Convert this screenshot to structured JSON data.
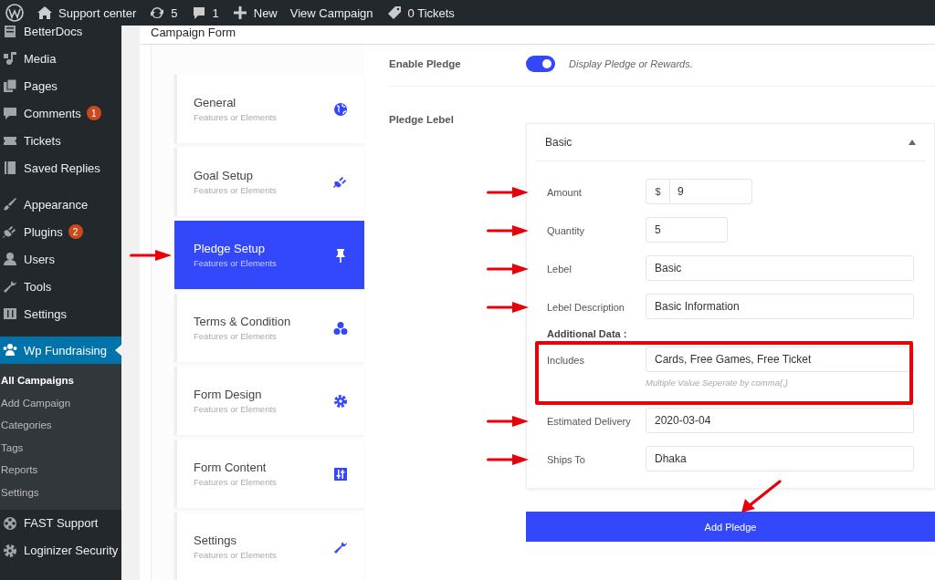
{
  "top_bar": {
    "site": "Support center",
    "updates": "5",
    "comments": "1",
    "new": "New",
    "view": "View Campaign",
    "tickets": "0 Tickets"
  },
  "sidebar": {
    "items": [
      {
        "label": "BetterDocs",
        "selected": false
      },
      {
        "label": "Media",
        "selected": false
      },
      {
        "label": "Pages",
        "selected": false
      },
      {
        "label": "Comments",
        "badge": "1",
        "selected": false
      },
      {
        "label": "Tickets",
        "selected": false
      },
      {
        "label": "Saved Replies",
        "selected": false,
        "separator_after": true
      },
      {
        "label": "Appearance",
        "selected": false
      },
      {
        "label": "Plugins",
        "badge": "2",
        "selected": false
      },
      {
        "label": "Users",
        "selected": false
      },
      {
        "label": "Tools",
        "selected": false
      },
      {
        "label": "Settings",
        "selected": false,
        "separator_after": true
      },
      {
        "label": "Wp Fundraising",
        "selected": true,
        "submenu": [
          {
            "label": "All Campaigns",
            "selected": true
          },
          {
            "label": "Add Campaign",
            "selected": false
          },
          {
            "label": "Categories",
            "selected": false
          },
          {
            "label": "Tags",
            "selected": false
          },
          {
            "label": "Reports",
            "selected": false
          },
          {
            "label": "Settings",
            "selected": false
          }
        ]
      },
      {
        "label": "FAST Support",
        "selected": false
      },
      {
        "label": "Loginizer Security",
        "selected": false
      }
    ]
  },
  "page_title": "Campaign Form",
  "steps": [
    {
      "title": "General",
      "subtitle": "Features or Elements",
      "selected": false,
      "arrow": false
    },
    {
      "title": "Goal Setup",
      "subtitle": "Features or Elements",
      "selected": false,
      "arrow": false
    },
    {
      "title": "Pledge Setup",
      "subtitle": "Features or Elements",
      "selected": true,
      "arrow": true
    },
    {
      "title": "Terms & Condition",
      "subtitle": "Features or Elements",
      "selected": false,
      "arrow": false
    },
    {
      "title": "Form Design",
      "subtitle": "Features or Elements",
      "selected": false,
      "arrow": false
    },
    {
      "title": "Form Content",
      "subtitle": "Features or Elements",
      "selected": false,
      "arrow": false
    },
    {
      "title": "Settings",
      "subtitle": "Features or Elements",
      "selected": false,
      "arrow": false
    }
  ],
  "enable_pledge": {
    "label": "Enable Pledge",
    "on": true,
    "description": "Display Pledge or Rewards."
  },
  "pledge_label": {
    "label": "Pledge Lebel",
    "accordion": {
      "title": "Basic",
      "expanded": true,
      "fields": [
        {
          "kind": "prefixed",
          "label": "Amount",
          "prefix": "$",
          "value": "9",
          "arrow": true,
          "highlighted": false
        },
        {
          "kind": "short",
          "label": "Quantity",
          "value": "5",
          "arrow": true,
          "highlighted": false
        },
        {
          "kind": "text",
          "label": "Lebel",
          "value": "Basic",
          "arrow": true,
          "highlighted": false
        },
        {
          "kind": "text",
          "label": "Lebel Description",
          "value": "Basic Information",
          "arrow": true,
          "highlighted": false
        },
        {
          "kind": "heading",
          "label": "Additional Data :"
        },
        {
          "kind": "text",
          "label": "Includes",
          "value": "Cards, Free Games, Free Ticket",
          "hint": "Multiple Value Seperate by comma(,)",
          "arrow": false,
          "highlighted": true
        },
        {
          "kind": "text",
          "label": "Estimated Delivery",
          "value": "2020-03-04",
          "arrow": true,
          "highlighted": false
        },
        {
          "kind": "text",
          "label": "Ships To",
          "value": "Dhaka",
          "arrow": true,
          "highlighted": false
        }
      ]
    }
  },
  "add_button": {
    "label": "Add Pledge",
    "arrow": true
  }
}
